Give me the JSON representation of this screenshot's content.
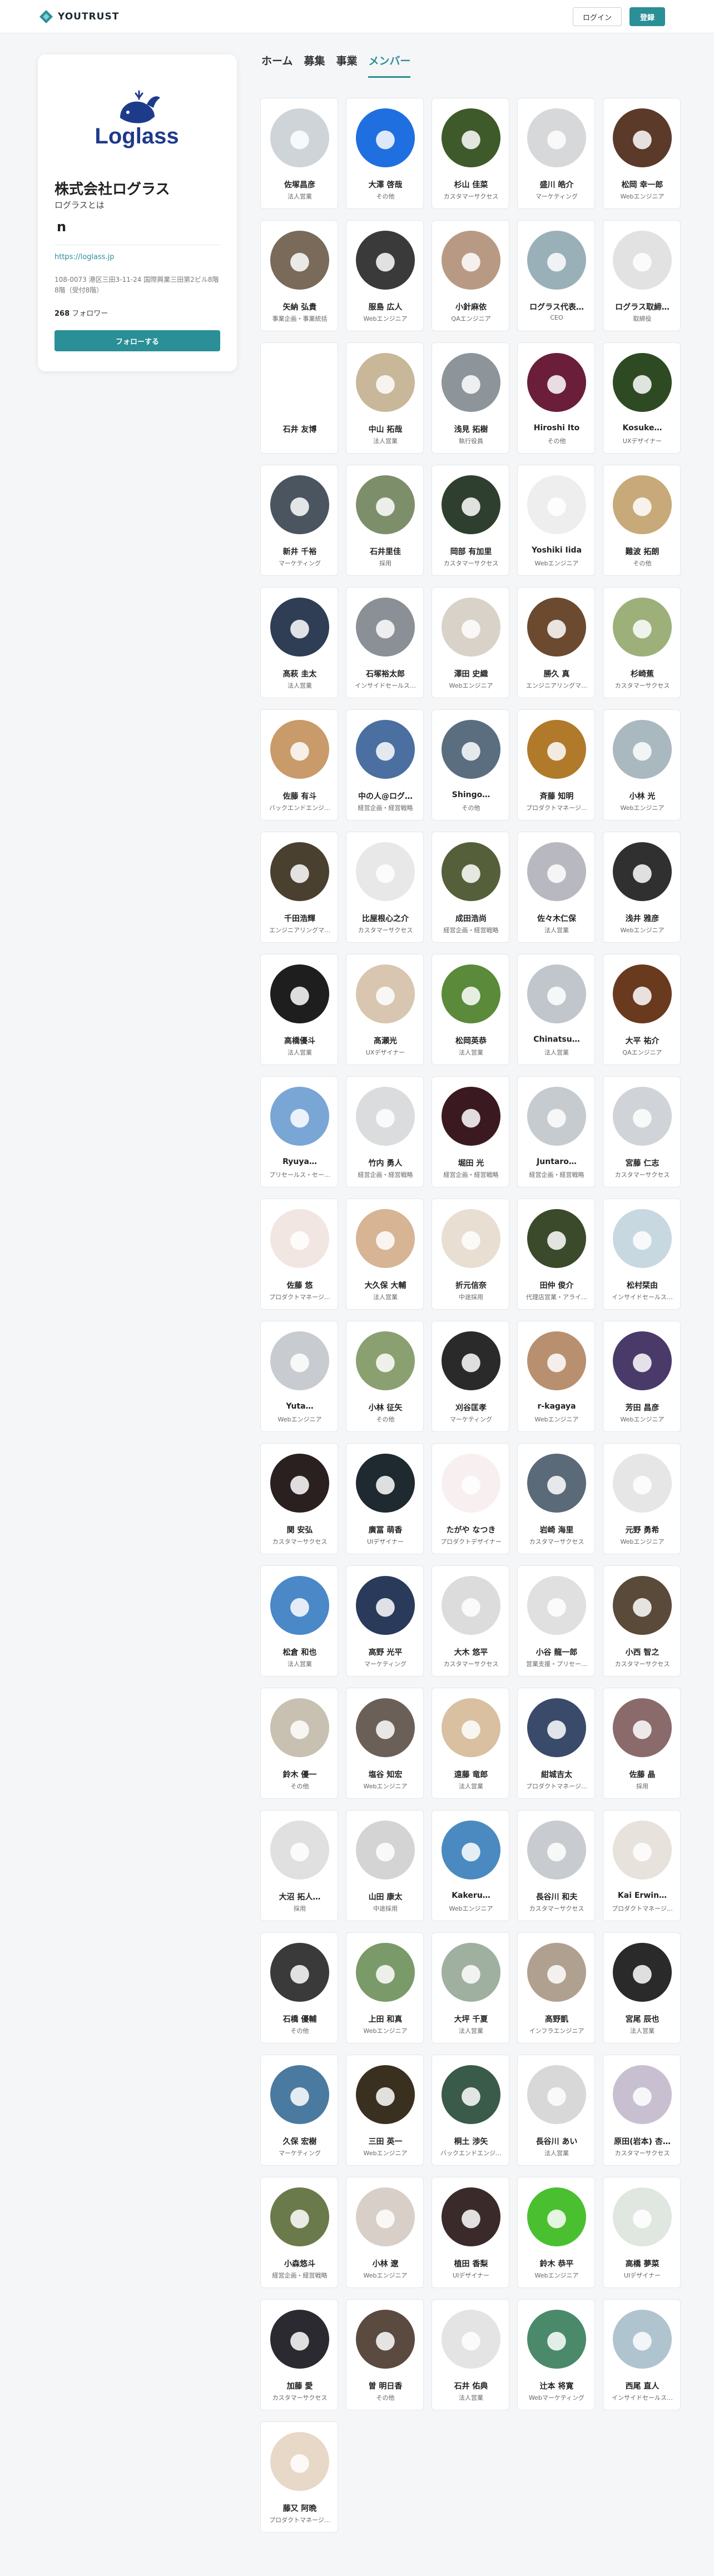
{
  "header": {
    "brand": "YOUTRUST",
    "login_label": "ログイン",
    "signup_label": "登録",
    "brand_color": "#2a8f96"
  },
  "company": {
    "logo_text": "Loglass",
    "name": "株式会社ログラス",
    "about": "ログラスとは",
    "initial": "n",
    "url": "https://loglass.jp",
    "address": "108-0073 港区三田3-11-24 国際興業三田第2ビル8階8階（受付8階）",
    "followers_count": "268",
    "followers_label": "フォロワー",
    "follow_label": "フォローする"
  },
  "tabs": [
    {
      "label": "ホーム",
      "active": false
    },
    {
      "label": "募集",
      "active": false
    },
    {
      "label": "事業",
      "active": false
    },
    {
      "label": "メンバー",
      "active": true
    }
  ],
  "members": [
    {
      "name": "佐塚昌彦",
      "role": "法人営業",
      "color": "#cfd4d9",
      "icon": "person-icon"
    },
    {
      "name": "大澤 啓哉",
      "role": "その他",
      "color": "#1f6fe0",
      "icon": "person-icon"
    },
    {
      "name": "杉山 佳菜",
      "role": "カスタマーサクセス",
      "color": "#3e5a2a",
      "icon": "person-icon"
    },
    {
      "name": "盛川 皓介",
      "role": "マーケティング",
      "color": "#d6d8da",
      "icon": "person-icon"
    },
    {
      "name": "松岡 幸一郎",
      "role": "Webエンジニア",
      "color": "#5b3a2a",
      "icon": "person-icon"
    },
    {
      "name": "矢納 弘貴",
      "role": "事業企画・事業統括",
      "color": "#7a6a5a",
      "icon": "person-icon"
    },
    {
      "name": "服島 広人",
      "role": "Webエンジニア",
      "color": "#3a3a3a",
      "icon": "person-icon"
    },
    {
      "name": "小針麻依",
      "role": "QAエンジニア",
      "color": "#b89a84",
      "icon": "person-icon"
    },
    {
      "name": "ログラス代表…",
      "role": "CEO",
      "color": "#9ab0b8",
      "icon": "person-icon"
    },
    {
      "name": "ログラス取締…",
      "role": "取締役",
      "color": "#e2e2e2",
      "icon": "person-icon"
    },
    {
      "name": "石井 友博",
      "role": "",
      "color": "#ffffff",
      "icon": "person-icon"
    },
    {
      "name": "中山 拓哉",
      "role": "法人営業",
      "color": "#c9b79a",
      "icon": "person-icon"
    },
    {
      "name": "浅見 拓樹",
      "role": "執行役員",
      "color": "#8d959b",
      "icon": "person-icon"
    },
    {
      "name": "Hiroshi Ito",
      "role": "その他",
      "color": "#6a1e3a",
      "icon": "person-icon"
    },
    {
      "name": "Kosuke…",
      "role": "UXデザイナー",
      "color": "#2e4a22",
      "icon": "person-icon"
    },
    {
      "name": "新井 千裕",
      "role": "マーケティング",
      "color": "#4a5560",
      "icon": "person-icon"
    },
    {
      "name": "石井里佳",
      "role": "採用",
      "color": "#7d8f6a",
      "icon": "person-icon"
    },
    {
      "name": "岡部 有加里",
      "role": "カスタマーサクセス",
      "color": "#2f3f2f",
      "icon": "person-icon"
    },
    {
      "name": "Yoshiki Iida",
      "role": "Webエンジニア",
      "color": "#eeeeee",
      "icon": "person-icon"
    },
    {
      "name": "難波 拓朗",
      "role": "その他",
      "color": "#c8a97a",
      "icon": "person-icon"
    },
    {
      "name": "髙萩 圭太",
      "role": "法人営業",
      "color": "#2f3e55",
      "icon": "person-icon"
    },
    {
      "name": "石塚裕太郎",
      "role": "インサイドセールス…",
      "color": "#8a9096",
      "icon": "person-icon"
    },
    {
      "name": "澤田 史織",
      "role": "Webエンジニア",
      "color": "#d9d2c8",
      "icon": "person-icon"
    },
    {
      "name": "勝久 真",
      "role": "エンジニアリングマ…",
      "color": "#6b4a30",
      "icon": "person-icon"
    },
    {
      "name": "杉崎蕉",
      "role": "カスタマーサクセス",
      "color": "#9db07a",
      "icon": "person-icon"
    },
    {
      "name": "佐藤 有斗",
      "role": "バックエンドエンジ…",
      "color": "#c99a6a",
      "icon": "person-icon"
    },
    {
      "name": "中の人@ログ…",
      "role": "経営企画・経営戦略",
      "color": "#4a6fa0",
      "icon": "person-icon"
    },
    {
      "name": "Shingo…",
      "role": "その他",
      "color": "#5a6e80",
      "icon": "person-icon"
    },
    {
      "name": "斉藤 知明",
      "role": "プロダクトマネージ…",
      "color": "#b07a2a",
      "icon": "person-icon"
    },
    {
      "name": "小林 光",
      "role": "Webエンジニア",
      "color": "#aab8c0",
      "icon": "person-icon"
    },
    {
      "name": "千田浩輝",
      "role": "エンジニアリングマ…",
      "color": "#4a4030",
      "icon": "person-icon"
    },
    {
      "name": "比屋根心之介",
      "role": "カスタマーサクセス",
      "color": "#e8e8e8",
      "icon": "person-icon"
    },
    {
      "name": "成田浩尚",
      "role": "経営企画・経営戦略",
      "color": "#55603a",
      "icon": "person-icon"
    },
    {
      "name": "佐々木仁保",
      "role": "法人営業",
      "color": "#b8b8c0",
      "icon": "person-icon"
    },
    {
      "name": "浅井 雅彦",
      "role": "Webエンジニア",
      "color": "#303030",
      "icon": "person-icon"
    },
    {
      "name": "高橋優斗",
      "role": "法人営業",
      "color": "#1e1e1e",
      "icon": "person-icon"
    },
    {
      "name": "髙瀬光",
      "role": "UXデザイナー",
      "color": "#d8c6b0",
      "icon": "person-icon"
    },
    {
      "name": "松岡英恭",
      "role": "法人営業",
      "color": "#5a8a3a",
      "icon": "person-icon"
    },
    {
      "name": "Chinatsu…",
      "role": "法人営業",
      "color": "#c0c6cc",
      "icon": "person-icon"
    },
    {
      "name": "大平 祐介",
      "role": "QAエンジニア",
      "color": "#6a3a1e",
      "icon": "person-icon"
    },
    {
      "name": "Ryuya…",
      "role": "プリセールス・セー…",
      "color": "#7aa6d6",
      "icon": "person-icon"
    },
    {
      "name": "竹内 勇人",
      "role": "経営企画・経営戦略",
      "color": "#dadcde",
      "icon": "person-icon"
    },
    {
      "name": "堀田 光",
      "role": "経営企画・経営戦略",
      "color": "#3a1a20",
      "icon": "person-icon"
    },
    {
      "name": "Juntaro…",
      "role": "経営企画・経営戦略",
      "color": "#c6cbd0",
      "icon": "person-icon"
    },
    {
      "name": "宮藤 仁志",
      "role": "カスタマーサクセス",
      "color": "#d0d4d8",
      "icon": "person-icon"
    },
    {
      "name": "佐藤 悠",
      "role": "プロダクトマネージ…",
      "color": "#f2e6e2",
      "icon": "person-icon"
    },
    {
      "name": "大久保 大輔",
      "role": "法人営業",
      "color": "#d6b494",
      "icon": "person-icon"
    },
    {
      "name": "折元信奈",
      "role": "中途採用",
      "color": "#e8ded2",
      "icon": "person-icon"
    },
    {
      "name": "田仲 俊介",
      "role": "代理店営業・アライ…",
      "color": "#3a4a2a",
      "icon": "person-icon"
    },
    {
      "name": "松村栞由",
      "role": "インサイドセールス…",
      "color": "#c8d8e0",
      "icon": "person-icon"
    },
    {
      "name": "Yuta…",
      "role": "Webエンジニア",
      "color": "#c8ccd0",
      "icon": "person-icon"
    },
    {
      "name": "小林 征矢",
      "role": "その他",
      "color": "#8aa070",
      "icon": "person-icon"
    },
    {
      "name": "刈谷匡孝",
      "role": "マーケティング",
      "color": "#2a2a2a",
      "icon": "person-icon"
    },
    {
      "name": "r-kagaya",
      "role": "Webエンジニア",
      "color": "#b89070",
      "icon": "person-icon"
    },
    {
      "name": "芳田 昌彦",
      "role": "Webエンジニア",
      "color": "#4a3a6a",
      "icon": "person-icon"
    },
    {
      "name": "関 安弘",
      "role": "カスタマーサクセス",
      "color": "#2a2020",
      "icon": "person-icon"
    },
    {
      "name": "廣冨 萌香",
      "role": "UIデザイナー",
      "color": "#1e2a30",
      "icon": "person-icon"
    },
    {
      "name": "たがや なつき",
      "role": "プロダクトデザイナー",
      "color": "#f8f0f0",
      "icon": "person-icon"
    },
    {
      "name": "岩崎 海里",
      "role": "カスタマーサクセス",
      "color": "#5a6a78",
      "icon": "person-icon"
    },
    {
      "name": "元野 勇希",
      "role": "Webエンジニア",
      "color": "#e6e6e6",
      "icon": "person-icon"
    },
    {
      "name": "松倉 和也",
      "role": "法人営業",
      "color": "#4a88c8",
      "icon": "person-icon"
    },
    {
      "name": "高野 光平",
      "role": "マーケティング",
      "color": "#2a3a5a",
      "icon": "person-icon"
    },
    {
      "name": "大木 悠平",
      "role": "カスタマーサクセス",
      "color": "#dcdcdc",
      "icon": "person-icon"
    },
    {
      "name": "小谷 龍一郎",
      "role": "営業支援・プリセー…",
      "color": "#e0e0e0",
      "icon": "person-icon"
    },
    {
      "name": "小西 智之",
      "role": "カスタマーサクセス",
      "color": "#5a4a3a",
      "icon": "person-icon"
    },
    {
      "name": "鈴木 優一",
      "role": "その他",
      "color": "#c8c0b0",
      "icon": "person-icon"
    },
    {
      "name": "塩谷 知宏",
      "role": "Webエンジニア",
      "color": "#6a6058",
      "icon": "person-icon"
    },
    {
      "name": "遠藤 竜郎",
      "role": "法人営業",
      "color": "#d8c0a0",
      "icon": "person-icon"
    },
    {
      "name": "紺城吉太",
      "role": "プロダクトマネージ…",
      "color": "#3a4a6a",
      "icon": "person-icon"
    },
    {
      "name": "佐藤 晶",
      "role": "採用",
      "color": "#8a6a6a",
      "icon": "person-icon"
    },
    {
      "name": "大沼 拓人…",
      "role": "採用",
      "color": "#e0e0e0",
      "icon": "person-icon"
    },
    {
      "name": "山田 康太",
      "role": "中途採用",
      "color": "#d4d4d4",
      "icon": "person-icon"
    },
    {
      "name": "Kakeru…",
      "role": "Webエンジニア",
      "color": "#4a8ac0",
      "icon": "person-icon"
    },
    {
      "name": "長谷川 和夫",
      "role": "カスタマーサクセス",
      "color": "#c8ccd0",
      "icon": "person-icon"
    },
    {
      "name": "Kai Erwin…",
      "role": "プロダクトマネージ…",
      "color": "#e8e2dc",
      "icon": "person-icon"
    },
    {
      "name": "石橋 優輔",
      "role": "その他",
      "color": "#3a3a3a",
      "icon": "person-icon"
    },
    {
      "name": "上田 和真",
      "role": "Webエンジニア",
      "color": "#7a9a6a",
      "icon": "person-icon"
    },
    {
      "name": "大坪 千夏",
      "role": "法人営業",
      "color": "#a0b0a0",
      "icon": "person-icon"
    },
    {
      "name": "髙野凱",
      "role": "インフラエンジニア",
      "color": "#b0a090",
      "icon": "person-icon"
    },
    {
      "name": "宮尾 辰也",
      "role": "法人営業",
      "color": "#2a2a2a",
      "icon": "person-icon"
    },
    {
      "name": "久保 宏樹",
      "role": "マーケティング",
      "color": "#4a7aa0",
      "icon": "person-icon"
    },
    {
      "name": "三田 英一",
      "role": "Webエンジニア",
      "color": "#3a3020",
      "icon": "person-icon"
    },
    {
      "name": "桐土 渉矢",
      "role": "バックエンドエンジ…",
      "color": "#3a5a4a",
      "icon": "person-icon"
    },
    {
      "name": "長谷川 あい",
      "role": "法人営業",
      "color": "#d8d8d8",
      "icon": "person-icon"
    },
    {
      "name": "原田(岩本) 杏…",
      "role": "カスタマーサクセス",
      "color": "#c8c0d0",
      "icon": "person-icon"
    },
    {
      "name": "小森悠斗",
      "role": "経営企画・経営戦略",
      "color": "#6a7a4a",
      "icon": "person-icon"
    },
    {
      "name": "小林 遼",
      "role": "Webエンジニア",
      "color": "#d8d0c8",
      "icon": "person-icon"
    },
    {
      "name": "植田 香梨",
      "role": "UIデザイナー",
      "color": "#3a2a2a",
      "icon": "person-icon"
    },
    {
      "name": "鈴木 恭平",
      "role": "Webエンジニア",
      "color": "#4ac030",
      "icon": "person-icon"
    },
    {
      "name": "高橋 夢菜",
      "role": "UIデザイナー",
      "color": "#e0e6e0",
      "icon": "person-icon"
    },
    {
      "name": "加藤 愛",
      "role": "カスタマーサクセス",
      "color": "#2a2a30",
      "icon": "person-icon"
    },
    {
      "name": "曽 明日香",
      "role": "その他",
      "color": "#5a4a40",
      "icon": "person-icon"
    },
    {
      "name": "石井 佑典",
      "role": "法人営業",
      "color": "#e4e4e4",
      "icon": "person-icon"
    },
    {
      "name": "辻本 将寛",
      "role": "Webマーケティング",
      "color": "#4a8a6a",
      "icon": "person-icon"
    },
    {
      "name": "西尾 直人",
      "role": "インサイドセールス…",
      "color": "#b0c4d0",
      "icon": "person-icon"
    },
    {
      "name": "藤又 阿晩",
      "role": "プロダクトマネージ…",
      "color": "#e8d8c8",
      "icon": "person-icon"
    }
  ]
}
